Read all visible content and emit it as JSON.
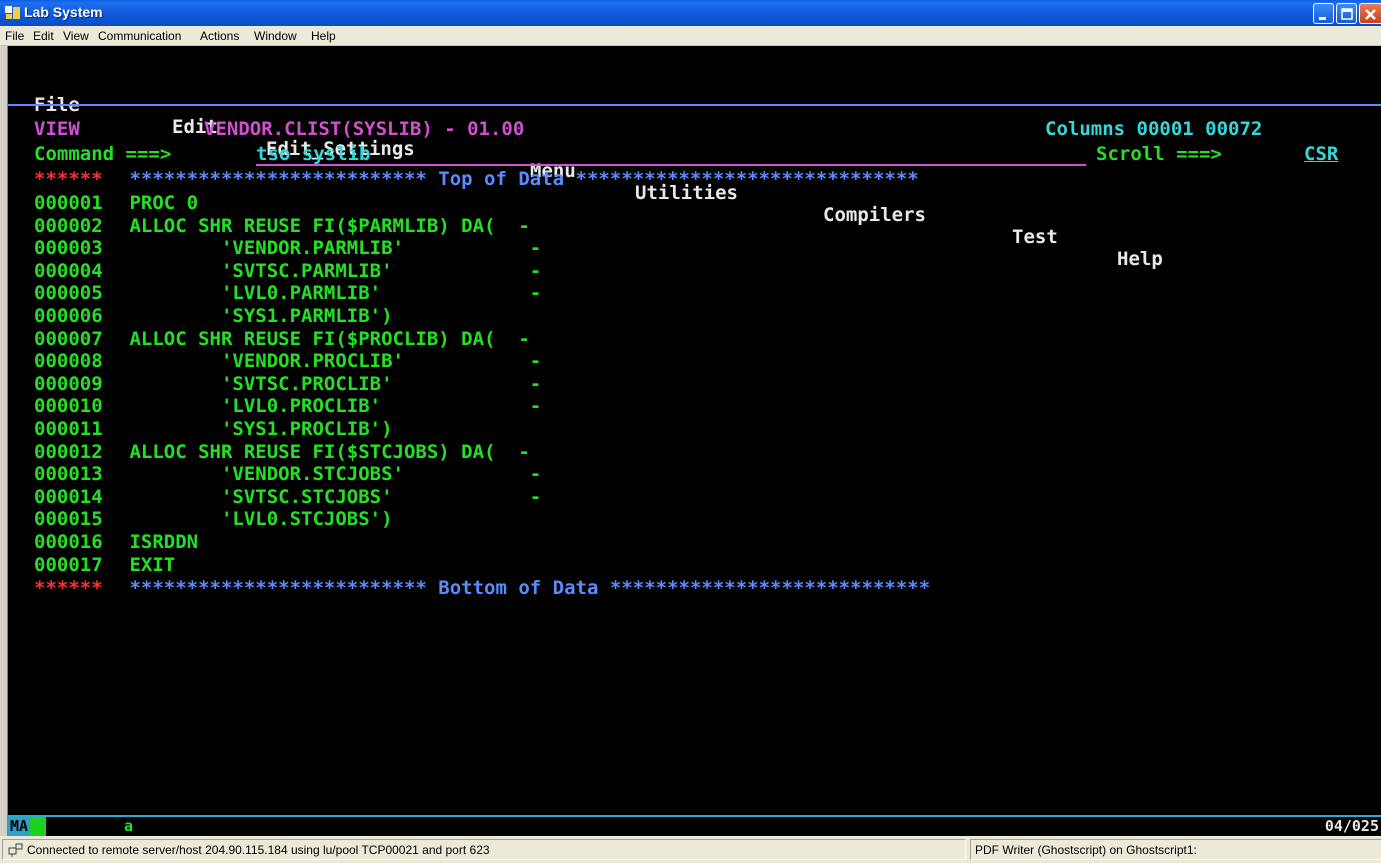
{
  "window": {
    "title": "Lab System"
  },
  "host_menu": [
    "File",
    "Edit",
    "View",
    "Communication",
    "Actions",
    "Window",
    "Help"
  ],
  "action_bar": [
    "File",
    "Edit",
    "Edit_Settings",
    "Menu",
    "Utilities",
    "Compilers",
    "Test",
    "Help"
  ],
  "header": {
    "mode": "VIEW",
    "dataset": "VENDOR.CLIST(SYSLIB) - 01.00",
    "columns": "Columns 00001 00072",
    "command_label": "Command ===>",
    "command_value": "tso syslib",
    "scroll_label": "Scroll ===>",
    "scroll_value": "CSR"
  },
  "top_marker": {
    "prefix": "******",
    "text": " ************************** Top of Data ******************************"
  },
  "lines": [
    {
      "num": "000001",
      "text": " PROC 0"
    },
    {
      "num": "000002",
      "text": " ALLOC SHR REUSE FI($PARMLIB) DA(  -"
    },
    {
      "num": "000003",
      "text": "         'VENDOR.PARMLIB'           -"
    },
    {
      "num": "000004",
      "text": "         'SVTSC.PARMLIB'            -"
    },
    {
      "num": "000005",
      "text": "         'LVL0.PARMLIB'             -"
    },
    {
      "num": "000006",
      "text": "         'SYS1.PARMLIB')"
    },
    {
      "num": "000007",
      "text": " ALLOC SHR REUSE FI($PROCLIB) DA(  -"
    },
    {
      "num": "000008",
      "text": "         'VENDOR.PROCLIB'           -"
    },
    {
      "num": "000009",
      "text": "         'SVTSC.PROCLIB'            -"
    },
    {
      "num": "000010",
      "text": "         'LVL0.PROCLIB'             -"
    },
    {
      "num": "000011",
      "text": "         'SYS1.PROCLIB')"
    },
    {
      "num": "000012",
      "text": " ALLOC SHR REUSE FI($STCJOBS) DA(  -"
    },
    {
      "num": "000013",
      "text": "         'VENDOR.STCJOBS'           -"
    },
    {
      "num": "000014",
      "text": "         'SVTSC.STCJOBS'            -"
    },
    {
      "num": "000015",
      "text": "         'LVL0.STCJOBS')"
    },
    {
      "num": "000016",
      "text": " ISRDDN"
    },
    {
      "num": "000017",
      "text": " EXIT"
    }
  ],
  "bottom_marker": {
    "prefix": "******",
    "text": " ************************** Bottom of Data ****************************"
  },
  "oia": {
    "indicator": "MA",
    "session": "a",
    "cursor_pos": "04/025"
  },
  "status": {
    "connection": "Connected to remote server/host 204.90.115.184 using lu/pool TCP00021 and port 623",
    "printer": "PDF Writer (Ghostscript) on Ghostscript1:"
  },
  "colors": {
    "green": "#24e024",
    "blue": "#5a8cff",
    "magenta": "#d050d0",
    "red": "#ff3030"
  }
}
